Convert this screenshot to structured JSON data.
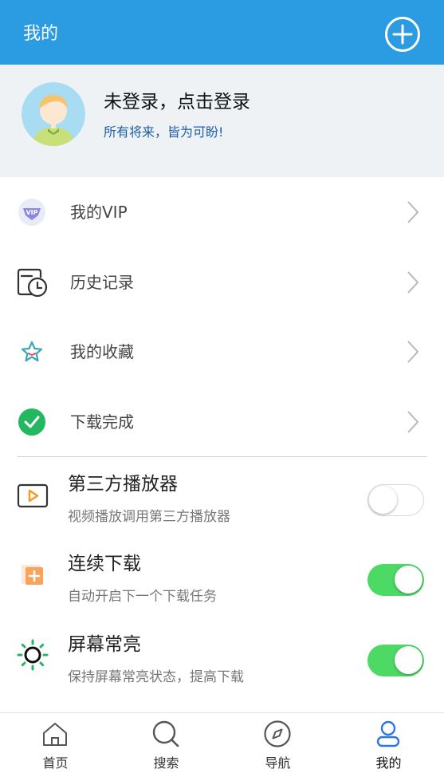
{
  "header": {
    "title": "我的",
    "add_icon": "plus-circle-icon"
  },
  "profile": {
    "login_text": "未登录，点击登录",
    "motto": "所有将来，皆为可盼!",
    "avatar_icon": "avatar"
  },
  "menu": [
    {
      "label": "我的VIP",
      "icon": "vip-icon"
    },
    {
      "label": "历史记录",
      "icon": "history-icon"
    },
    {
      "label": "我的收藏",
      "icon": "star-icon"
    },
    {
      "label": "下载完成",
      "icon": "check-circle-icon"
    }
  ],
  "settings": [
    {
      "name": "第三方播放器",
      "desc": "视频播放调用第三方播放器",
      "enabled": false,
      "icon": "player-icon"
    },
    {
      "name": "连续下载",
      "desc": "自动开启下一个下载任务",
      "enabled": true,
      "icon": "download-queue-icon"
    },
    {
      "name": "屏幕常亮",
      "desc": "保持屏幕常亮状态，提高下载",
      "enabled": true,
      "icon": "sun-icon"
    }
  ],
  "bottom_nav": [
    {
      "label": "首页",
      "icon": "home-icon"
    },
    {
      "label": "搜索",
      "icon": "search-icon"
    },
    {
      "label": "导航",
      "icon": "compass-icon"
    },
    {
      "label": "我的",
      "icon": "user-icon",
      "active": true
    }
  ],
  "colors": {
    "primary": "#2b9be2",
    "toggle_on": "#4cd964",
    "profile_bg": "#eef2f5",
    "motto": "#1d5fa8",
    "active_nav": "#2b78e4"
  }
}
